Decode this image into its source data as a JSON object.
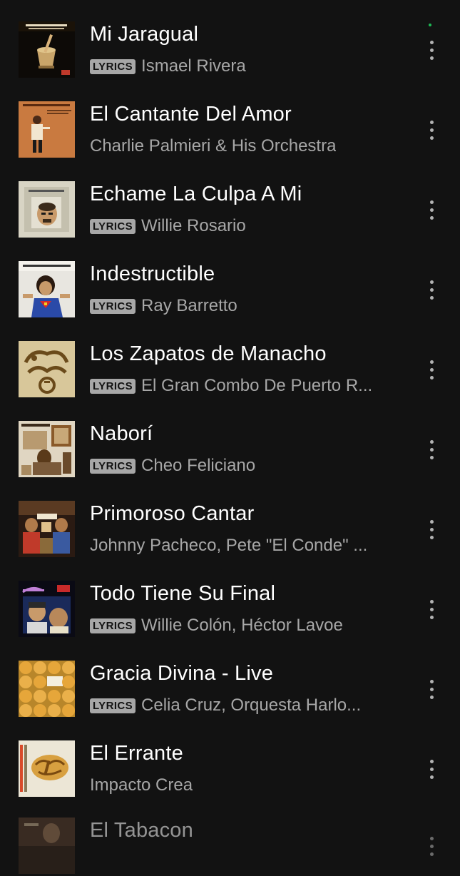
{
  "badge_label": "LYRICS",
  "colors": {
    "background": "#121212",
    "title": "#ffffff",
    "subtitle": "#a7a7a7",
    "badge_bg": "#a7a7a7",
    "accent": "#1db954"
  },
  "tracks": [
    {
      "title": "Mi Jaragual",
      "artist": "Ismael Rivera",
      "lyrics": true,
      "cover_icon": "album-cover-mi-jaragual"
    },
    {
      "title": "El Cantante Del Amor",
      "artist": "Charlie Palmieri & His Orchestra",
      "lyrics": false,
      "cover_icon": "album-cover-el-cantante-del-amor"
    },
    {
      "title": "Echame La Culpa A Mi",
      "artist": "Willie Rosario",
      "lyrics": true,
      "cover_icon": "album-cover-echame-la-culpa"
    },
    {
      "title": "Indestructible",
      "artist": "Ray Barretto",
      "lyrics": true,
      "cover_icon": "album-cover-indestructible"
    },
    {
      "title": "Los Zapatos de Manacho",
      "artist": "El Gran Combo De Puerto R...",
      "lyrics": true,
      "cover_icon": "album-cover-el-gran-combo"
    },
    {
      "title": "Naborí",
      "artist": "Cheo Feliciano",
      "lyrics": true,
      "cover_icon": "album-cover-cheo-feliciano"
    },
    {
      "title": "Primoroso Cantar",
      "artist": "Johnny Pacheco, Pete \"El Conde\" ...",
      "lyrics": false,
      "cover_icon": "album-cover-pacheco"
    },
    {
      "title": "Todo Tiene Su Final",
      "artist": "Willie Colón, Héctor Lavoe",
      "lyrics": true,
      "cover_icon": "album-cover-lo-mato"
    },
    {
      "title": "Gracia Divina - Live",
      "artist": "Celia Cruz, Orquesta Harlo...",
      "lyrics": true,
      "cover_icon": "album-cover-gracia-divina"
    },
    {
      "title": "El Errante",
      "artist": "Impacto Crea",
      "lyrics": false,
      "cover_icon": "album-cover-impacto-crea"
    },
    {
      "title": "El Tabacon",
      "artist": "",
      "lyrics": false,
      "cover_icon": "album-cover-el-tabacon"
    }
  ]
}
